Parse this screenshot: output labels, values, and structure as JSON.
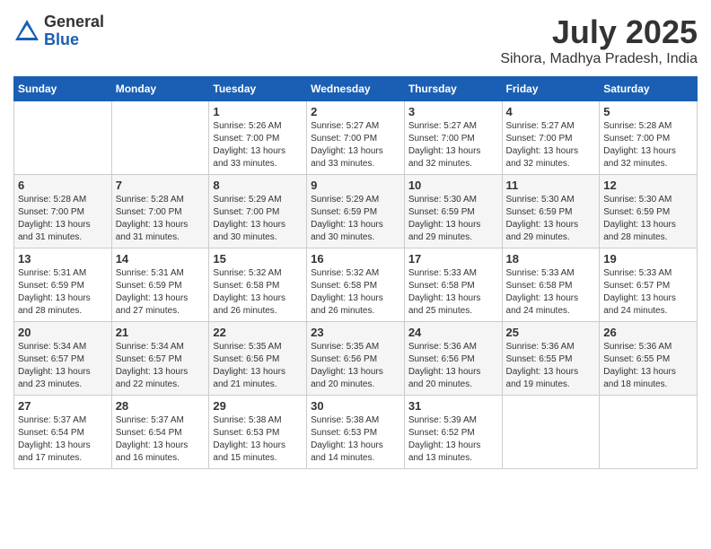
{
  "header": {
    "logo_general": "General",
    "logo_blue": "Blue",
    "month_year": "July 2025",
    "location": "Sihora, Madhya Pradesh, India"
  },
  "weekdays": [
    "Sunday",
    "Monday",
    "Tuesday",
    "Wednesday",
    "Thursday",
    "Friday",
    "Saturday"
  ],
  "weeks": [
    [
      {
        "day": "",
        "sunrise": "",
        "sunset": "",
        "daylight": ""
      },
      {
        "day": "",
        "sunrise": "",
        "sunset": "",
        "daylight": ""
      },
      {
        "day": "1",
        "sunrise": "Sunrise: 5:26 AM",
        "sunset": "Sunset: 7:00 PM",
        "daylight": "Daylight: 13 hours and 33 minutes."
      },
      {
        "day": "2",
        "sunrise": "Sunrise: 5:27 AM",
        "sunset": "Sunset: 7:00 PM",
        "daylight": "Daylight: 13 hours and 33 minutes."
      },
      {
        "day": "3",
        "sunrise": "Sunrise: 5:27 AM",
        "sunset": "Sunset: 7:00 PM",
        "daylight": "Daylight: 13 hours and 32 minutes."
      },
      {
        "day": "4",
        "sunrise": "Sunrise: 5:27 AM",
        "sunset": "Sunset: 7:00 PM",
        "daylight": "Daylight: 13 hours and 32 minutes."
      },
      {
        "day": "5",
        "sunrise": "Sunrise: 5:28 AM",
        "sunset": "Sunset: 7:00 PM",
        "daylight": "Daylight: 13 hours and 32 minutes."
      }
    ],
    [
      {
        "day": "6",
        "sunrise": "Sunrise: 5:28 AM",
        "sunset": "Sunset: 7:00 PM",
        "daylight": "Daylight: 13 hours and 31 minutes."
      },
      {
        "day": "7",
        "sunrise": "Sunrise: 5:28 AM",
        "sunset": "Sunset: 7:00 PM",
        "daylight": "Daylight: 13 hours and 31 minutes."
      },
      {
        "day": "8",
        "sunrise": "Sunrise: 5:29 AM",
        "sunset": "Sunset: 7:00 PM",
        "daylight": "Daylight: 13 hours and 30 minutes."
      },
      {
        "day": "9",
        "sunrise": "Sunrise: 5:29 AM",
        "sunset": "Sunset: 6:59 PM",
        "daylight": "Daylight: 13 hours and 30 minutes."
      },
      {
        "day": "10",
        "sunrise": "Sunrise: 5:30 AM",
        "sunset": "Sunset: 6:59 PM",
        "daylight": "Daylight: 13 hours and 29 minutes."
      },
      {
        "day": "11",
        "sunrise": "Sunrise: 5:30 AM",
        "sunset": "Sunset: 6:59 PM",
        "daylight": "Daylight: 13 hours and 29 minutes."
      },
      {
        "day": "12",
        "sunrise": "Sunrise: 5:30 AM",
        "sunset": "Sunset: 6:59 PM",
        "daylight": "Daylight: 13 hours and 28 minutes."
      }
    ],
    [
      {
        "day": "13",
        "sunrise": "Sunrise: 5:31 AM",
        "sunset": "Sunset: 6:59 PM",
        "daylight": "Daylight: 13 hours and 28 minutes."
      },
      {
        "day": "14",
        "sunrise": "Sunrise: 5:31 AM",
        "sunset": "Sunset: 6:59 PM",
        "daylight": "Daylight: 13 hours and 27 minutes."
      },
      {
        "day": "15",
        "sunrise": "Sunrise: 5:32 AM",
        "sunset": "Sunset: 6:58 PM",
        "daylight": "Daylight: 13 hours and 26 minutes."
      },
      {
        "day": "16",
        "sunrise": "Sunrise: 5:32 AM",
        "sunset": "Sunset: 6:58 PM",
        "daylight": "Daylight: 13 hours and 26 minutes."
      },
      {
        "day": "17",
        "sunrise": "Sunrise: 5:33 AM",
        "sunset": "Sunset: 6:58 PM",
        "daylight": "Daylight: 13 hours and 25 minutes."
      },
      {
        "day": "18",
        "sunrise": "Sunrise: 5:33 AM",
        "sunset": "Sunset: 6:58 PM",
        "daylight": "Daylight: 13 hours and 24 minutes."
      },
      {
        "day": "19",
        "sunrise": "Sunrise: 5:33 AM",
        "sunset": "Sunset: 6:57 PM",
        "daylight": "Daylight: 13 hours and 24 minutes."
      }
    ],
    [
      {
        "day": "20",
        "sunrise": "Sunrise: 5:34 AM",
        "sunset": "Sunset: 6:57 PM",
        "daylight": "Daylight: 13 hours and 23 minutes."
      },
      {
        "day": "21",
        "sunrise": "Sunrise: 5:34 AM",
        "sunset": "Sunset: 6:57 PM",
        "daylight": "Daylight: 13 hours and 22 minutes."
      },
      {
        "day": "22",
        "sunrise": "Sunrise: 5:35 AM",
        "sunset": "Sunset: 6:56 PM",
        "daylight": "Daylight: 13 hours and 21 minutes."
      },
      {
        "day": "23",
        "sunrise": "Sunrise: 5:35 AM",
        "sunset": "Sunset: 6:56 PM",
        "daylight": "Daylight: 13 hours and 20 minutes."
      },
      {
        "day": "24",
        "sunrise": "Sunrise: 5:36 AM",
        "sunset": "Sunset: 6:56 PM",
        "daylight": "Daylight: 13 hours and 20 minutes."
      },
      {
        "day": "25",
        "sunrise": "Sunrise: 5:36 AM",
        "sunset": "Sunset: 6:55 PM",
        "daylight": "Daylight: 13 hours and 19 minutes."
      },
      {
        "day": "26",
        "sunrise": "Sunrise: 5:36 AM",
        "sunset": "Sunset: 6:55 PM",
        "daylight": "Daylight: 13 hours and 18 minutes."
      }
    ],
    [
      {
        "day": "27",
        "sunrise": "Sunrise: 5:37 AM",
        "sunset": "Sunset: 6:54 PM",
        "daylight": "Daylight: 13 hours and 17 minutes."
      },
      {
        "day": "28",
        "sunrise": "Sunrise: 5:37 AM",
        "sunset": "Sunset: 6:54 PM",
        "daylight": "Daylight: 13 hours and 16 minutes."
      },
      {
        "day": "29",
        "sunrise": "Sunrise: 5:38 AM",
        "sunset": "Sunset: 6:53 PM",
        "daylight": "Daylight: 13 hours and 15 minutes."
      },
      {
        "day": "30",
        "sunrise": "Sunrise: 5:38 AM",
        "sunset": "Sunset: 6:53 PM",
        "daylight": "Daylight: 13 hours and 14 minutes."
      },
      {
        "day": "31",
        "sunrise": "Sunrise: 5:39 AM",
        "sunset": "Sunset: 6:52 PM",
        "daylight": "Daylight: 13 hours and 13 minutes."
      },
      {
        "day": "",
        "sunrise": "",
        "sunset": "",
        "daylight": ""
      },
      {
        "day": "",
        "sunrise": "",
        "sunset": "",
        "daylight": ""
      }
    ]
  ]
}
